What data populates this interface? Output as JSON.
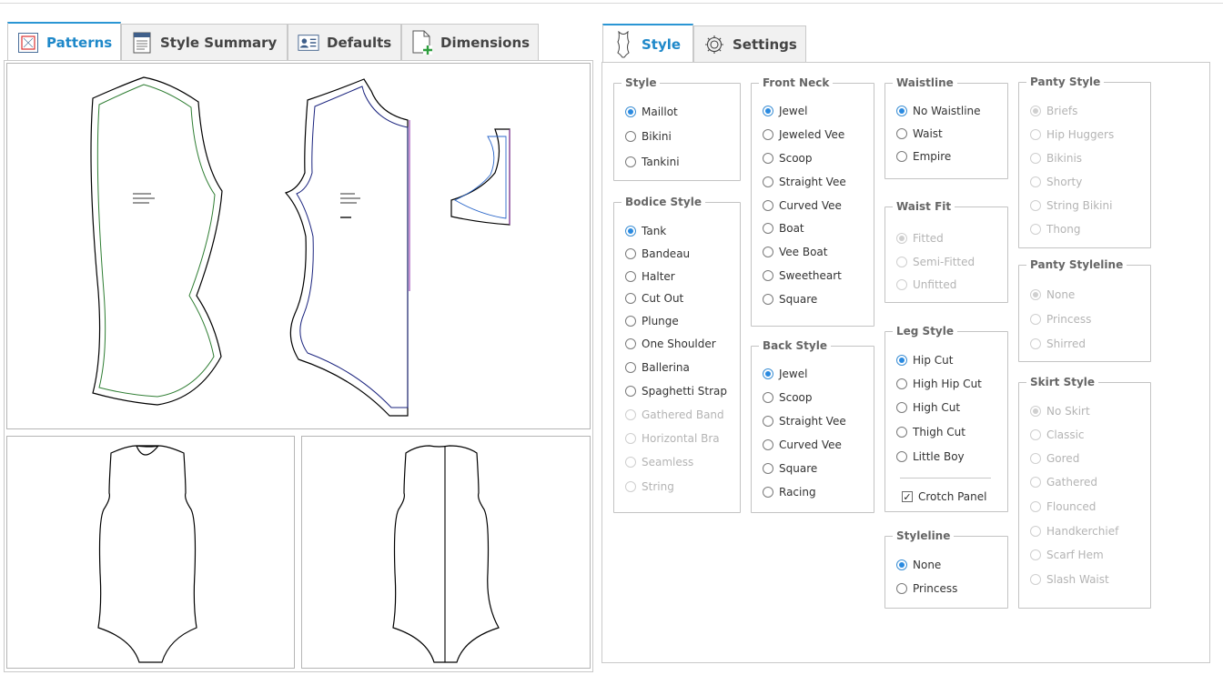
{
  "left_tabs": {
    "patterns": "Patterns",
    "style_summary": "Style Summary",
    "defaults": "Defaults",
    "dimensions": "Dimensions"
  },
  "right_tabs": {
    "style": "Style",
    "settings": "Settings"
  },
  "accent_color": "#1e88c9",
  "pattern_lines": {
    "outline": "#000000",
    "front_seam": "#2e7d32",
    "back_seam": "#1a237e",
    "grainline": "#8e24aa"
  },
  "groups": {
    "style": {
      "title": "Style",
      "options": [
        "Maillot",
        "Bikini",
        "Tankini"
      ]
    },
    "bodice_style": {
      "title": "Bodice Style",
      "options": [
        "Tank",
        "Bandeau",
        "Halter",
        "Cut Out",
        "Plunge",
        "One Shoulder",
        "Ballerina",
        "Spaghetti Strap",
        "Gathered Band",
        "Horizontal Bra",
        "Seamless",
        "String"
      ]
    },
    "front_neck": {
      "title": "Front Neck",
      "options": [
        "Jewel",
        "Jeweled Vee",
        "Scoop",
        "Straight Vee",
        "Curved Vee",
        "Boat",
        "Vee Boat",
        "Sweetheart",
        "Square"
      ]
    },
    "back_style": {
      "title": "Back Style",
      "options": [
        "Jewel",
        "Scoop",
        "Straight Vee",
        "Curved Vee",
        "Square",
        "Racing"
      ]
    },
    "waistline": {
      "title": "Waistline",
      "options": [
        "No Waistline",
        "Waist",
        "Empire"
      ]
    },
    "waist_fit": {
      "title": "Waist Fit",
      "options": [
        "Fitted",
        "Semi-Fitted",
        "Unfitted"
      ]
    },
    "leg_style": {
      "title": "Leg Style",
      "options": [
        "Hip Cut",
        "High Hip Cut",
        "High Cut",
        "Thigh Cut",
        "Little Boy"
      ],
      "checkbox": "Crotch Panel"
    },
    "styleline": {
      "title": "Styleline",
      "options": [
        "None",
        "Princess"
      ]
    },
    "panty_style": {
      "title": "Panty Style",
      "options": [
        "Briefs",
        "Hip Huggers",
        "Bikinis",
        "Shorty",
        "String Bikini",
        "Thong"
      ]
    },
    "panty_styleline": {
      "title": "Panty Styleline",
      "options": [
        "None",
        "Princess",
        "Shirred"
      ]
    },
    "skirt_style": {
      "title": "Skirt Style",
      "options": [
        "No Skirt",
        "Classic",
        "Gored",
        "Gathered",
        "Flounced",
        "Handkerchief",
        "Scarf Hem",
        "Slash Waist"
      ]
    }
  }
}
